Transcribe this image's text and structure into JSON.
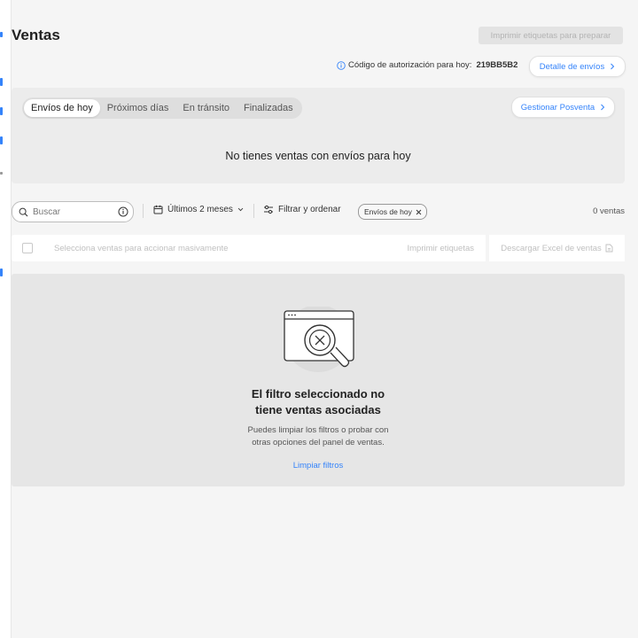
{
  "header": {
    "title": "Ventas",
    "print_button_label": "Imprimir etiquetas para preparar"
  },
  "auth": {
    "label": "Código de autorización para hoy:",
    "code": "219BB5B2",
    "details_button_label": "Detalle de envíos"
  },
  "shipments_panel": {
    "tabs": [
      {
        "label": "Envíos de hoy",
        "active": true
      },
      {
        "label": "Próximos días",
        "active": false
      },
      {
        "label": "En tránsito",
        "active": false
      },
      {
        "label": "Finalizadas",
        "active": false
      }
    ],
    "postsale_button_label": "Gestionar Posventa",
    "empty_message": "No tienes ventas con envíos para hoy"
  },
  "filters": {
    "search_placeholder": "Buscar",
    "period_label": "Últimos 2 meses",
    "filter_sort_label": "Filtrar y ordenar",
    "active_chip_label": "Envíos de hoy",
    "sales_count": "0 ventas"
  },
  "bulk_actions": {
    "select_hint": "Selecciona ventas para accionar masivamente",
    "print_labels": "Imprimir etiquetas",
    "download_excel": "Descargar Excel de ventas"
  },
  "empty_state": {
    "title_line1": "El filtro seleccionado no",
    "title_line2": "tiene ventas asociadas",
    "desc_line1": "Puedes limpiar los filtros o probar con",
    "desc_line2": "otras opciones del panel de ventas.",
    "clear_filters_label": "Limpiar filtros"
  },
  "colors": {
    "accent": "#3483fa",
    "background": "#f5f5f5",
    "panel": "#ececec",
    "disabled_button": "#e3e3e3"
  },
  "icons": {
    "auth_info": "info-icon",
    "search": "search-icon",
    "search_info": "info-circle-icon",
    "calendar": "calendar-icon",
    "filters": "sliders-icon",
    "chip_remove": "close-icon",
    "excel": "document-icon",
    "chevron": "chevron-right-icon",
    "empty_illustration": "browser-window-magnifier-x-icon"
  }
}
